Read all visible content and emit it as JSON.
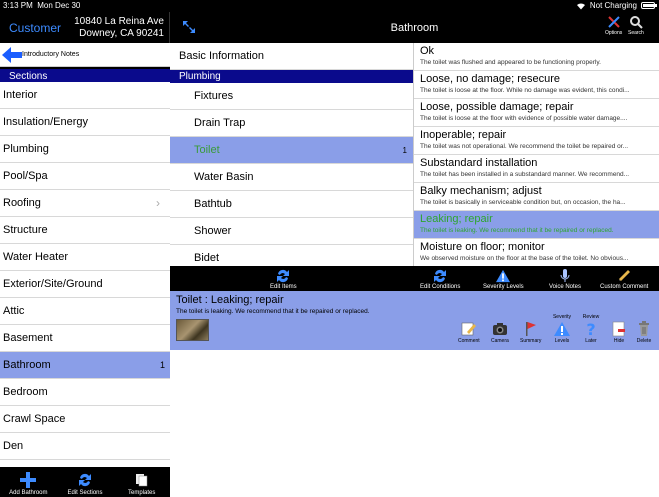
{
  "status": {
    "time": "3:13 PM",
    "date": "Mon Dec 30",
    "charging": "Not Charging"
  },
  "left_header": {
    "customer": "Customer",
    "address_line1": "10840 La Reina Ave",
    "address_line2": "Downey, CA 90241"
  },
  "back": {
    "label": "Introductory Notes"
  },
  "sections_header": "Sections",
  "sections": [
    {
      "label": "Interior",
      "count": ""
    },
    {
      "label": "Insulation/Energy",
      "count": ""
    },
    {
      "label": "Plumbing",
      "count": ""
    },
    {
      "label": "Pool/Spa",
      "count": ""
    },
    {
      "label": "Roofing",
      "count": ""
    },
    {
      "label": "Structure",
      "count": ""
    },
    {
      "label": "Water Heater",
      "count": ""
    },
    {
      "label": "Exterior/Site/Ground",
      "count": ""
    },
    {
      "label": "Attic",
      "count": ""
    },
    {
      "label": "Basement",
      "count": ""
    },
    {
      "label": "Bathroom",
      "count": "1"
    },
    {
      "label": "Bedroom",
      "count": ""
    },
    {
      "label": "Crawl Space",
      "count": ""
    },
    {
      "label": "Den",
      "count": ""
    }
  ],
  "left_toolbar": {
    "add": "Add Bathroom",
    "edit": "Edit Sections",
    "templates": "Templates"
  },
  "main_header": {
    "title": "Bathroom",
    "options": "Options",
    "search": "Search"
  },
  "items": {
    "basic": "Basic Information",
    "group": "Plumbing",
    "list": [
      {
        "label": "Fixtures",
        "count": ""
      },
      {
        "label": "Drain Trap",
        "count": ""
      },
      {
        "label": "Toilet",
        "count": "1"
      },
      {
        "label": "Water Basin",
        "count": ""
      },
      {
        "label": "Bathtub",
        "count": ""
      },
      {
        "label": "Shower",
        "count": ""
      },
      {
        "label": "Bidet",
        "count": ""
      }
    ]
  },
  "conditions": [
    {
      "title": "Ok",
      "desc": "The toilet was flushed and appeared to be functioning properly."
    },
    {
      "title": "Loose, no damage; resecure",
      "desc": "The toilet is loose at the floor. While no damage was evident, this condi..."
    },
    {
      "title": "Loose, possible damage; repair",
      "desc": "The toilet is loose at the floor with evidence of possible water damage...."
    },
    {
      "title": "Inoperable; repair",
      "desc": "The toilet was not operational. We recommend the toilet be repaired or..."
    },
    {
      "title": "Substandard installation",
      "desc": "The toilet has been installed in a substandard manner. We recommend..."
    },
    {
      "title": "Balky mechanism; adjust",
      "desc": "The toilet is basically in serviceable condition but, on occasion, the ha..."
    },
    {
      "title": "Leaking; repair",
      "desc": "The toilet is leaking. We recommend that it be repaired or replaced."
    },
    {
      "title": "Moisture on floor; monitor",
      "desc": "We observed moisture on the floor at the base of the toilet. No obvious..."
    }
  ],
  "item_toolbar": {
    "edit_items": "Edit Items"
  },
  "cond_toolbar": {
    "edit_conditions": "Edit Conditions",
    "severity": "Severity Levels",
    "voice": "Voice Notes",
    "custom": "Custom Comment"
  },
  "detail": {
    "title": "Toilet : Leaking; repair",
    "desc": "The toilet is leaking. We recommend that it be repaired or replaced.",
    "buttons": {
      "comment": "Comment",
      "camera": "Camera",
      "summary": "Summary",
      "severity_top": "Severity",
      "levels": "Levels",
      "review_top": "Review",
      "later": "Later",
      "hide": "Hide",
      "delete": "Delete"
    }
  },
  "colors": {
    "selection": "#8a9ee8",
    "header_blue": "#0a0a8c",
    "accent": "#3d8bff",
    "selected_text": "#2fa52f"
  }
}
